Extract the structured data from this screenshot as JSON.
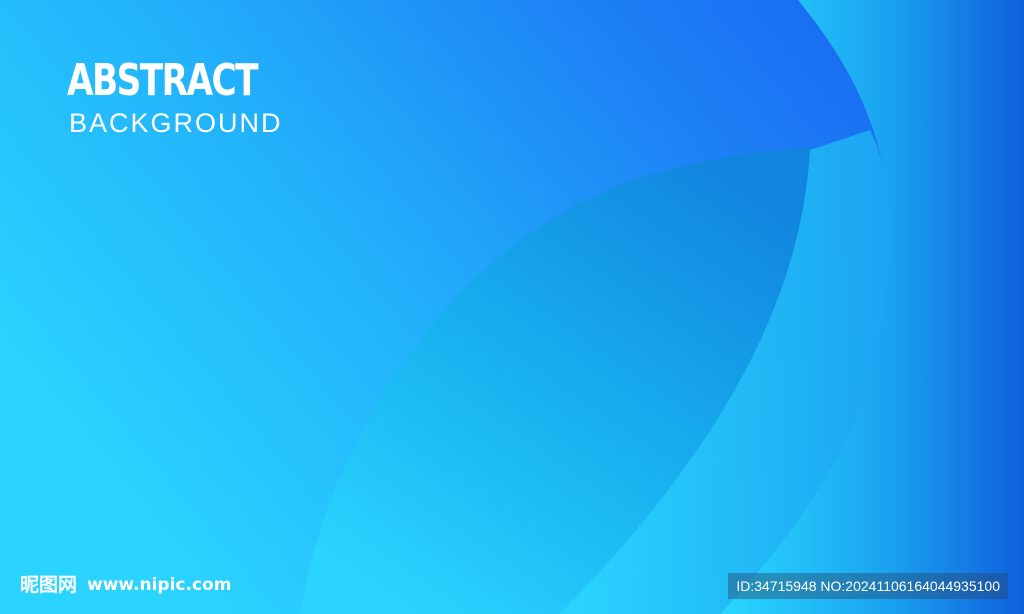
{
  "poster": {
    "title": "ABSTRACT",
    "subtitle": "BACKGROUND"
  },
  "watermark": {
    "brand": "昵图网",
    "site": "www.nipic.com",
    "id_text": "ID:34715948 NO:20241106164044935100"
  },
  "colors": {
    "light_cyan": "#2ad4ff",
    "mid_blue": "#1f8ef5",
    "deep_blue": "#1565f0",
    "dark_blue": "#0f4fd8",
    "leaf_blue": "#159ae6"
  }
}
